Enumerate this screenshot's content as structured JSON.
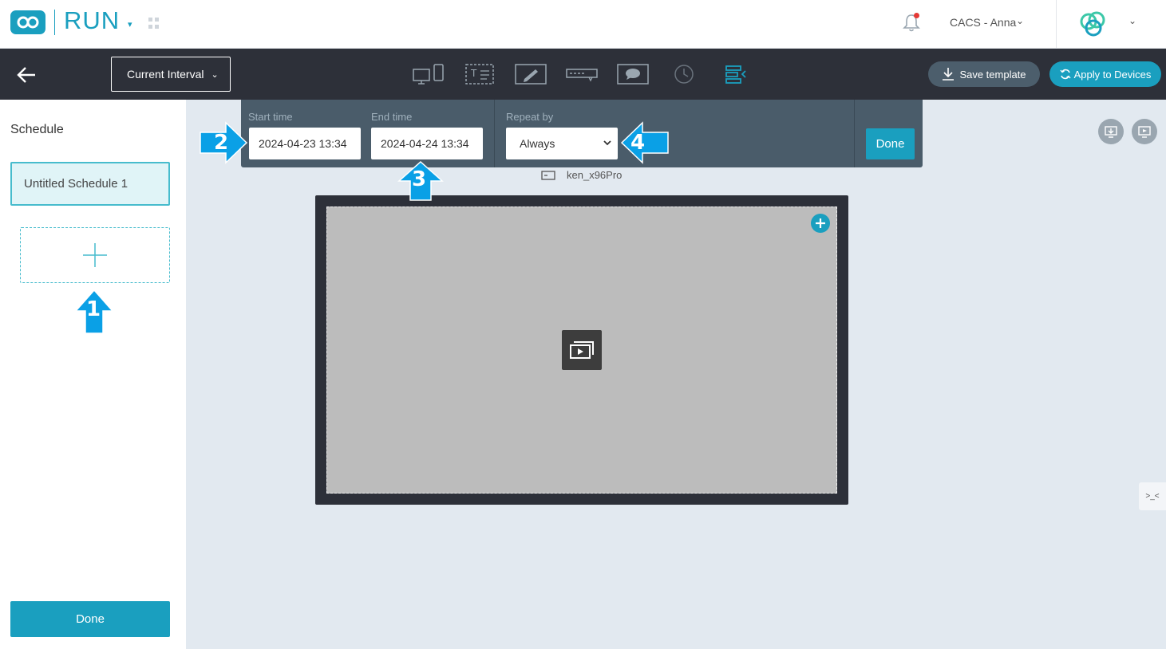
{
  "header": {
    "app_name": "RUN",
    "user_name": "CACS - Anna"
  },
  "toolbar": {
    "interval_label": "Current Interval",
    "save_template_label": "Save template",
    "apply_to_devices_label": "Apply to Devices",
    "tools": [
      "devices-icon",
      "text-widget-icon",
      "draw-widget-icon",
      "ticker-widget-icon",
      "message-widget-icon",
      "clock-widget-icon",
      "schedule-widget-icon"
    ]
  },
  "sidebar": {
    "title": "Schedule",
    "schedules": [
      {
        "label": "Untitled Schedule 1"
      }
    ],
    "done_label": "Done"
  },
  "time_panel": {
    "start_label": "Start time",
    "start_value": "2024-04-23 13:34",
    "end_label": "End time",
    "end_value": "2024-04-24 13:34",
    "repeat_label": "Repeat by",
    "repeat_value": "Always",
    "done_label": "Done"
  },
  "canvas": {
    "device_name": "ken_x96Pro"
  },
  "markers": {
    "step1": "1",
    "step2": "2",
    "step3": "3",
    "step4": "4"
  },
  "colors": {
    "accent": "#1a9fbf",
    "toolbar_bg": "#2d3039",
    "panel_bg": "#4a5c6a",
    "canvas_bg": "#e2e9f0",
    "marker": "#0aa0e6"
  }
}
